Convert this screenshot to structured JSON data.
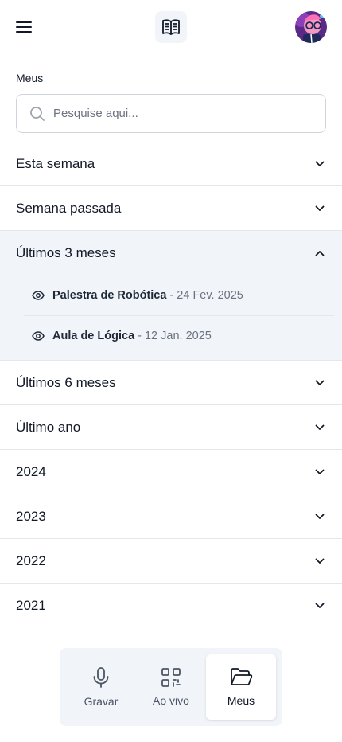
{
  "header": {
    "menu_icon": "hamburger-menu-icon",
    "logo_icon": "open-book-icon",
    "avatar_icon": "user-avatar"
  },
  "section": {
    "title": "Meus"
  },
  "search": {
    "placeholder": "Pesquise aqui...",
    "value": ""
  },
  "groups": [
    {
      "label": "Esta semana",
      "expanded": false
    },
    {
      "label": "Semana passada",
      "expanded": false
    },
    {
      "label": "Últimos 3 meses",
      "expanded": true,
      "items": [
        {
          "title": "Palestra de Robótica",
          "date": "- 24 Fev. 2025"
        },
        {
          "title": "Aula de Lógica",
          "date": "- 12 Jan. 2025"
        }
      ]
    },
    {
      "label": "Últimos 6 meses",
      "expanded": false
    },
    {
      "label": "Último ano",
      "expanded": false
    },
    {
      "label": "2024",
      "expanded": false
    },
    {
      "label": "2023",
      "expanded": false
    },
    {
      "label": "2022",
      "expanded": false
    },
    {
      "label": "2021",
      "expanded": false
    }
  ],
  "nav": [
    {
      "label": "Gravar",
      "icon": "microphone-icon",
      "active": false
    },
    {
      "label": "Ao vivo",
      "icon": "qr-code-icon",
      "active": false
    },
    {
      "label": "Meus",
      "icon": "folder-open-icon",
      "active": true
    }
  ],
  "colors": {
    "panel": "#f1f5f9",
    "border": "#e5e7eb",
    "text": "#111827",
    "muted": "#6b7280"
  }
}
